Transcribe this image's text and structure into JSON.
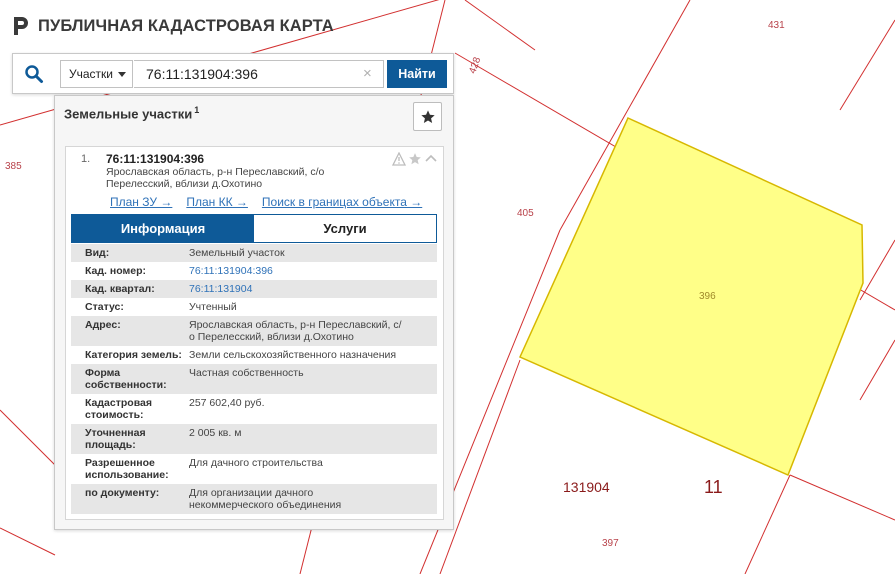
{
  "header": {
    "title": "ПУБЛИЧНАЯ КАДАСТРОВАЯ КАРТА"
  },
  "search": {
    "type_selected": "Участки",
    "value": "76:11:131904:396",
    "clear_glyph": "×",
    "button_label": "Найти"
  },
  "results": {
    "title": "Земельные участки",
    "count": "1",
    "card": {
      "index": "1.",
      "number": "76:11:131904:396",
      "address_lines": [
        "Ярославская область, р-н Переславский, с/о",
        "Перелесский, вблизи д.Охотино"
      ],
      "links": [
        "План ЗУ →",
        "План КК →",
        "Поиск в границах объекта →"
      ],
      "tabs": [
        "Информация",
        "Услуги"
      ],
      "attributes": [
        {
          "key": [
            "Вид:"
          ],
          "value": [
            "Земельный участок"
          ],
          "link": false
        },
        {
          "key": [
            "Кад. номер:"
          ],
          "value": [
            "76:11:131904:396"
          ],
          "link": true
        },
        {
          "key": [
            "Кад. квартал:"
          ],
          "value": [
            "76:11:131904"
          ],
          "link": true
        },
        {
          "key": [
            "Статус:"
          ],
          "value": [
            "Учтенный"
          ],
          "link": false
        },
        {
          "key": [
            "Адрес:"
          ],
          "value": [
            "Ярославская область, р-н Переславский, с/",
            "о Перелесский, вблизи д.Охотино"
          ],
          "link": false
        },
        {
          "key": [
            "Категория земель:"
          ],
          "value": [
            "Земли сельскохозяйственного назначения"
          ],
          "link": false
        },
        {
          "key": [
            "Форма",
            "собственности:"
          ],
          "value": [
            "Частная собственность"
          ],
          "link": false
        },
        {
          "key": [
            "Кадастровая",
            "стоимость:"
          ],
          "value": [
            "257 602,40 руб."
          ],
          "link": false
        },
        {
          "key": [
            "Уточненная",
            "площадь:"
          ],
          "value": [
            "2 005 кв. м"
          ],
          "link": false
        },
        {
          "key": [
            "Разрешенное",
            "использование:"
          ],
          "value": [
            "Для дачного строительства"
          ],
          "link": false
        },
        {
          "key": [
            "по документу:"
          ],
          "value": [
            "Для организации дачного",
            "некоммерческого объединения"
          ],
          "link": false
        }
      ]
    }
  },
  "map": {
    "parcel_labels": [
      "431",
      "428",
      "385",
      "405",
      "396",
      "397"
    ],
    "quarter_label": "131904",
    "district_label": "11",
    "colors": {
      "boundary": "#d23030",
      "selected_fill": "#ffff88",
      "selected_stroke": "#d7b800",
      "brand": "#0e5a98"
    }
  },
  "icons": [
    "logo-icon",
    "search-icon",
    "caret-down-icon",
    "clear-icon",
    "star-icon",
    "warning-icon",
    "chevron-up-icon"
  ]
}
